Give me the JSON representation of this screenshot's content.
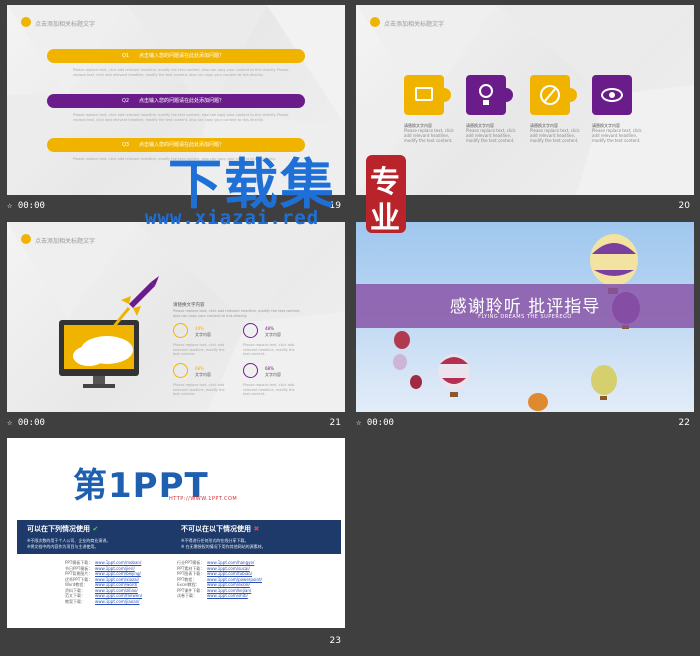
{
  "slides": [
    {
      "number": "19",
      "time": "00:00",
      "title": "点击添加相关标题文字",
      "items": [
        {
          "q": "Q1",
          "text": "点击输入您的问题请在此处添加问题？",
          "color": "#f0b400",
          "para": "Please replace text, click add relevant headline, modify the text content, also can copy your content to this directly. Please replace text, click add relevant headline, modify the text content, also can copy your content to this directly."
        },
        {
          "q": "Q2",
          "text": "点击输入您的问题请在此处添加问题？",
          "color": "#6a1d8a",
          "para": "Please replace text, click add relevant headline, modify the text content, also can copy your content to this directly. Please replace text, click add relevant headline, modify the text content, also can copy your content to this directly."
        },
        {
          "q": "Q3",
          "text": "点击输入您的问题请在此处添加问题？",
          "color": "#f0b400",
          "para": "Please replace text, click add relevant headline, modify the text content, also can copy your content to this directly."
        }
      ]
    },
    {
      "number": "20",
      "time": "",
      "title": "点击添加相关标题文字",
      "pieces": [
        {
          "color": "#f0b400",
          "label": "请替换文字内容",
          "text": "Please replace text, click add relevant headline, modify the text content."
        },
        {
          "color": "#6a1d8a",
          "label": "请替换文字内容",
          "text": "Please replace text, click add relevant headline, modify the text content."
        },
        {
          "color": "#f0b400",
          "label": "请替换文字内容",
          "text": "Please replace text, click add relevant headline, modify the text content."
        },
        {
          "color": "#6a1d8a",
          "label": "请替换文字内容",
          "text": "Please replace text, click add relevant headline, modify the text content."
        }
      ]
    },
    {
      "number": "21",
      "time": "00:00",
      "title": "点击添加相关标题文字",
      "heading": "请替换文字内容",
      "intro": "Please replace text, click add relevant headline, modify the text content, also can copy your content to this directly.",
      "stats": [
        {
          "pct": "48%",
          "label": "文字内容",
          "text": "Please replace text, click add relevant headline, modify the text content."
        },
        {
          "pct": "48%",
          "label": "文字内容",
          "text": "Please replace text, click add relevant headline, modify the text content."
        },
        {
          "pct": "68%",
          "label": "文字内容",
          "text": "Please replace text, click add relevant headline, modify the text content."
        },
        {
          "pct": "68%",
          "label": "文字内容",
          "text": "Please replace text, click add relevant headline, modify the text content."
        }
      ]
    },
    {
      "number": "22",
      "time": "00:00",
      "title": "感谢聆听  批评指导",
      "subtitle": "FLYING  DREAMS THE SUPEREGO"
    },
    {
      "number": "23",
      "time": "",
      "logo": "第1PPT",
      "logo_url": "HTTP://WWW.1PPT.COM",
      "can_title": "可以在下列情况使用",
      "can_lines": [
        "※不限次数的用于个人公司、企业的商业演讲。",
        "※将文档中的内容作为项目与主讲使用。"
      ],
      "cannot_title": "不可以在以下情况使用",
      "cannot_lines": [
        "※不得进行任何形式的在线分享下载。",
        "※ 在无需授权的情况下用作其他网站的源素材。"
      ],
      "left_links": [
        {
          "label": "PPT模板下载：",
          "url": "www.1ppt.com/moban/"
        },
        {
          "label": "节日PPT模板：",
          "url": "www.1ppt.com/jieri/"
        },
        {
          "label": "PPT背景图片：",
          "url": "www.1ppt.com/beijing/"
        },
        {
          "label": "优秀PPT下载：",
          "url": "www.1ppt.com/xiazai/"
        },
        {
          "label": "Word教程：",
          "url": "www.1ppt.com/word/"
        },
        {
          "label": "资料下载：",
          "url": "www.1ppt.com/ziliao/"
        },
        {
          "label": "范文下载：",
          "url": "www.1ppt.com/fanwen/"
        },
        {
          "label": "教案下载：",
          "url": "www.1ppt.com/jiaoan/"
        }
      ],
      "right_links": [
        {
          "label": "行业PPT模板：",
          "url": "www.1ppt.com/hangye/"
        },
        {
          "label": "PPT素材下载：",
          "url": "www.1ppt.com/sucai/"
        },
        {
          "label": "PPT图表下载：",
          "url": "www.1ppt.com/tubiao/"
        },
        {
          "label": "PPT教程：",
          "url": "www.1ppt.com/powerpoint/"
        },
        {
          "label": "Excel教程：",
          "url": "www.1ppt.com/excel/"
        },
        {
          "label": "PPT课件下载：",
          "url": "www.1ppt.com/kejian/"
        },
        {
          "label": "试卷下载：",
          "url": "www.1ppt.com/shiti/"
        }
      ]
    }
  ],
  "watermark": {
    "main": "下载集",
    "url": "www.xiazai.red",
    "seal": [
      "专",
      "业"
    ]
  }
}
